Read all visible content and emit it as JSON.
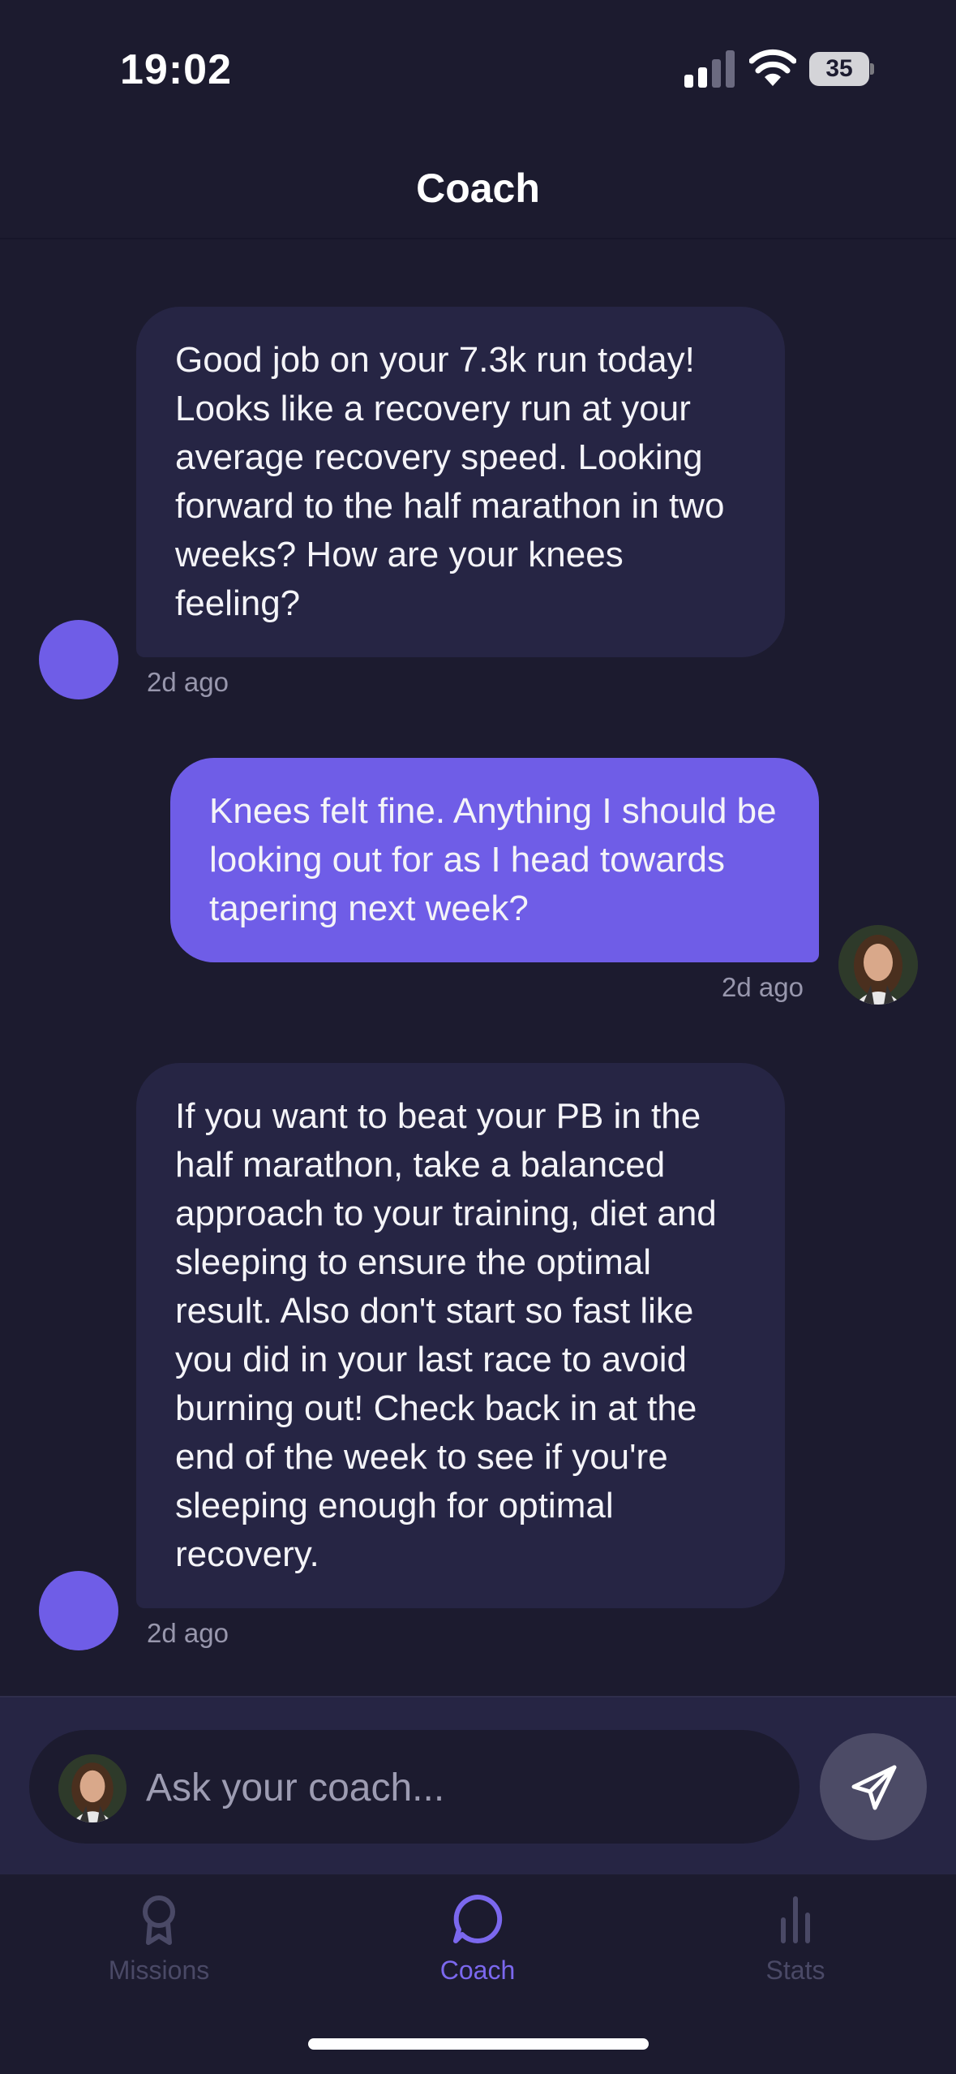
{
  "status_bar": {
    "time": "19:02",
    "battery": "35"
  },
  "header": {
    "title": "Coach"
  },
  "messages": [
    {
      "sender": "coach",
      "text": "Good job on your 7.3k run today! Looks like a recovery run at your average recovery speed. Looking forward to the half marathon in two weeks? How are your knees feeling?",
      "timestamp": "2d ago"
    },
    {
      "sender": "user",
      "text": "Knees felt fine. Anything I should be looking out for as I head towards tapering next week?",
      "timestamp": "2d ago"
    },
    {
      "sender": "coach",
      "text": "If you want to beat your PB in the half marathon, take a balanced approach to your training, diet and sleeping to ensure the optimal result. Also don't start so fast like you did in your last race to avoid burning out! Check back in at the end of the week to see if you're sleeping enough for optimal recovery.",
      "timestamp": "2d ago"
    }
  ],
  "input": {
    "placeholder": "Ask your coach...",
    "value": ""
  },
  "tabs": [
    {
      "label": "Missions",
      "icon": "award-ribbon-icon",
      "active": false
    },
    {
      "label": "Coach",
      "icon": "chat-bubble-icon",
      "active": true
    },
    {
      "label": "Stats",
      "icon": "bar-chart-icon",
      "active": false
    }
  ],
  "colors": {
    "background": "#1c1b2f",
    "coach_bubble": "#262544",
    "user_bubble": "#6f5de7",
    "accent": "#7b68ee",
    "muted_text": "#9897ad"
  }
}
